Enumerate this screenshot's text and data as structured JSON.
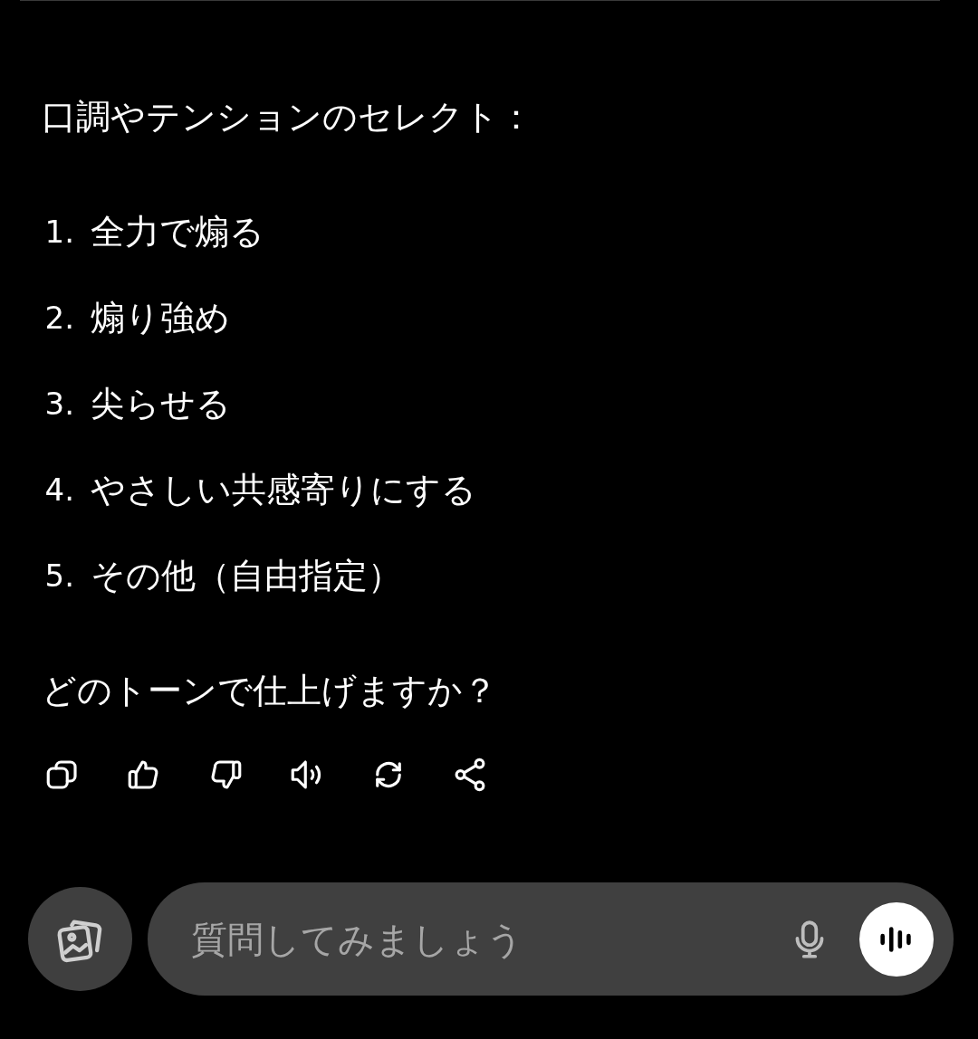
{
  "message": {
    "intro": "口調やテンションのセレクト：",
    "options": [
      {
        "number": "1.",
        "text": "全力で煽る"
      },
      {
        "number": "2.",
        "text": "煽り強め"
      },
      {
        "number": "3.",
        "text": "尖らせる"
      },
      {
        "number": "4.",
        "text": "やさしい共感寄りにする"
      },
      {
        "number": "5.",
        "text": "その他（自由指定）"
      }
    ],
    "question": "どのトーンで仕上げますか？",
    "actions": [
      {
        "kind": "copy"
      },
      {
        "kind": "like"
      },
      {
        "kind": "dislike"
      },
      {
        "kind": "speak"
      },
      {
        "kind": "regenerate"
      },
      {
        "kind": "share"
      }
    ]
  },
  "composer": {
    "placeholder": "質問してみましょう"
  }
}
